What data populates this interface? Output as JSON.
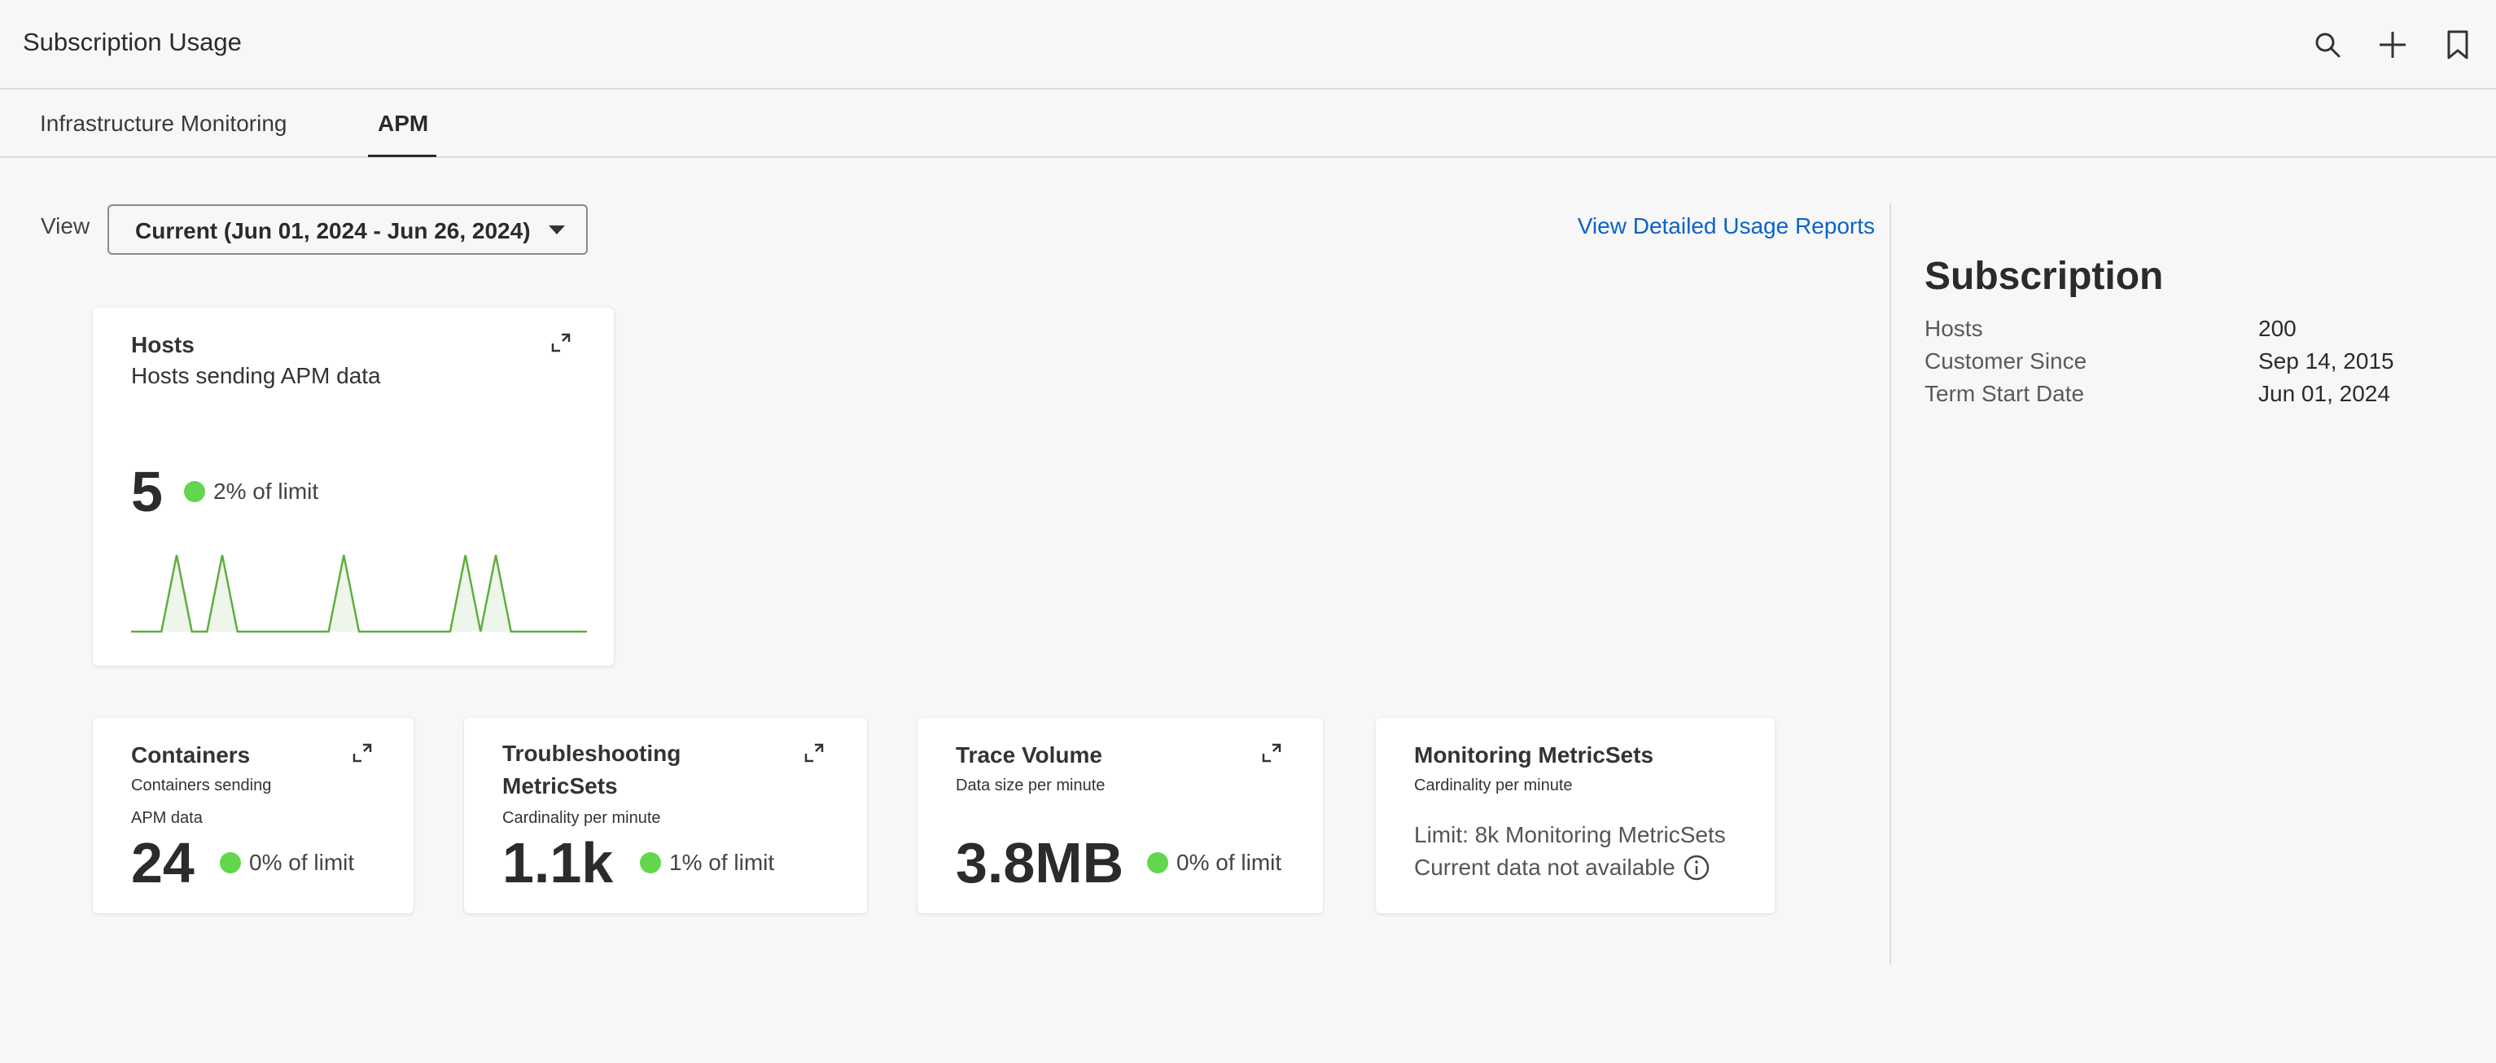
{
  "header": {
    "title": "Subscription Usage",
    "icons": [
      "search-icon",
      "plus-icon",
      "bookmark-icon"
    ]
  },
  "tabs": [
    {
      "label": "Infrastructure Monitoring",
      "active": false
    },
    {
      "label": "APM",
      "active": true
    }
  ],
  "view": {
    "label": "View",
    "selected": "Current (Jun 01, 2024 - Jun 26, 2024)"
  },
  "detail_link": "View Detailed Usage Reports",
  "cards": {
    "hosts": {
      "title": "Hosts",
      "subtitle": "Hosts sending APM data",
      "value": "5",
      "status": "2% of limit",
      "sparkline": [
        0,
        0,
        0,
        1,
        0,
        0,
        1,
        0,
        0,
        0,
        0,
        0,
        0,
        0,
        1,
        0,
        0,
        0,
        0,
        0,
        0,
        0,
        1,
        0,
        1,
        0,
        0,
        0,
        0,
        0,
        0
      ]
    },
    "containers": {
      "title": "Containers",
      "subtitle_line1": "Containers sending",
      "subtitle_line2": "APM data",
      "value": "24",
      "status": "0% of limit"
    },
    "troubleshooting": {
      "title_line1": "Troubleshooting",
      "title_line2": "MetricSets",
      "subtitle": "Cardinality per minute",
      "value": "1.1k",
      "status": "1% of limit"
    },
    "trace_volume": {
      "title": "Trace Volume",
      "subtitle": "Data size per minute",
      "value": "3.8MB",
      "status": "0% of limit"
    },
    "monitoring": {
      "title": "Monitoring MetricSets",
      "subtitle": "Cardinality per minute",
      "limit_text": "Limit: 8k Monitoring MetricSets",
      "unavailable_text": "Current data not available"
    }
  },
  "subscription": {
    "title": "Subscription",
    "rows": [
      {
        "label": "Hosts",
        "value": "200"
      },
      {
        "label": "Customer Since",
        "value": "Sep 14, 2015"
      },
      {
        "label": "Term Start Date",
        "value": "Jun 01, 2024"
      }
    ]
  },
  "colors": {
    "accent_link": "#0b63c8",
    "status_ok": "#62d64c",
    "sparkline_stroke": "#5fae3f",
    "sparkline_fill": "#eef5ea"
  }
}
